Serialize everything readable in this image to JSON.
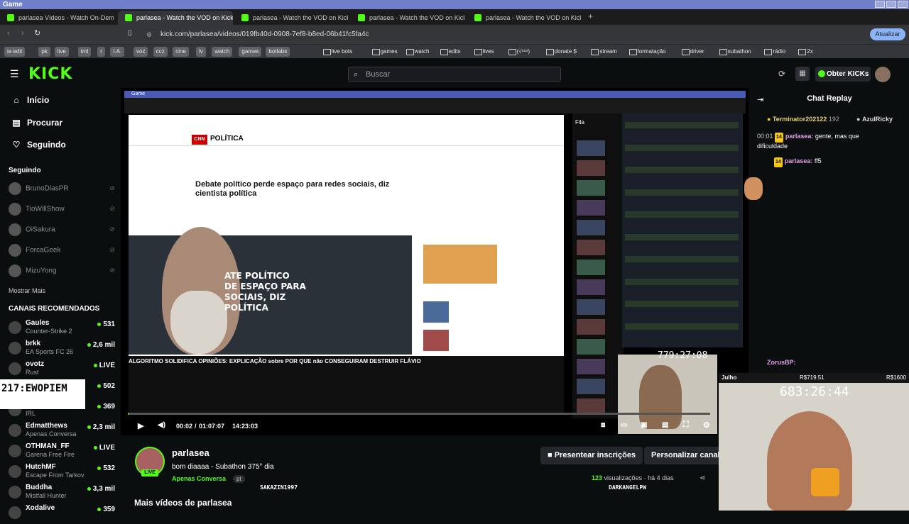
{
  "window": {
    "title": "Game"
  },
  "tabs": [
    {
      "label": "parlasea Vídeos - Watch On-Demand"
    },
    {
      "label": "parlasea - Watch the VOD on Kick"
    },
    {
      "label": "parlasea - Watch the VOD on Kick"
    },
    {
      "label": "parlasea - Watch the VOD on Kick"
    },
    {
      "label": "parlasea - Watch the VOD on Kick"
    }
  ],
  "address": {
    "url": "kick.com/parlasea/videos/019fb40d-0908-7ef8-b8ed-06b41fc5fa4c",
    "update_label": "Atualizar"
  },
  "bookmarks": [
    "ia edit",
    "pk",
    "live",
    "tml",
    "r",
    "I.A.",
    "voz",
    "ccz",
    "cine",
    "lv",
    "watch",
    "games",
    "botlabs",
    "live bots",
    "games",
    "watch",
    "edits",
    "lives",
    "(√ᵒ¹ᵒ)",
    "donate $",
    "stream",
    "formatação",
    "driver",
    "subathon",
    "rádio",
    "2x"
  ],
  "header": {
    "search_placeholder": "Buscar",
    "obter_label": "Obter KICKs",
    "logo": "KICK"
  },
  "sidebar": {
    "nav": [
      {
        "label": "Início"
      },
      {
        "label": "Procurar"
      },
      {
        "label": "Seguindo"
      }
    ],
    "following_title": "Seguindo",
    "following": [
      "BrunoDiasPR",
      "TioWillShow",
      "OiSakura",
      "ForcaGeek",
      "MizuYong"
    ],
    "show_more": "Mostrar Mais",
    "recommended_title": "CANAIS RECOMENDADOS",
    "recommended": [
      {
        "name": "Gaules",
        "game": "Counter-Strike 2",
        "viewers": "531"
      },
      {
        "name": "brkk",
        "game": "EA Sports FC 26",
        "viewers": "2,6 mil"
      },
      {
        "name": "ovotz",
        "game": "Rust",
        "viewers": "LIVE"
      },
      {
        "name": "",
        "game": "",
        "viewers": "502"
      },
      {
        "name": "",
        "game": "IRL",
        "viewers": "369"
      },
      {
        "name": "Edmatthews",
        "game": "Apenas Conversa",
        "viewers": "2,3 mil"
      },
      {
        "name": "OTHMAN_FF",
        "game": "Garena Free Fire",
        "viewers": "LIVE"
      },
      {
        "name": "HutchMF",
        "game": "Escape From Tarkov",
        "viewers": "532"
      },
      {
        "name": "Buddha",
        "game": "Mistfall Hunter",
        "viewers": "3,3 mil"
      },
      {
        "name": "Xodalive",
        "game": "",
        "viewers": "359"
      }
    ]
  },
  "video": {
    "inner_window_title": "Game",
    "cnn_section": "POLÍTICA",
    "cnn_logo": "CNN",
    "headline": "Debate político perde espaço para redes sociais, diz cientista política",
    "overlay_text": "ATE POLÍTICO\nDE ESPAÇO PARA\nSOCIAIS, DIZ\nPOLÍTICA",
    "yt_title": "ALGORITMO SOLIDIFICA OPINIÕES: EXPLICAÇÃO sobre POR QUE não CONSEGUIRAM DESTRUIR FLÁVIO",
    "fila_label": "Fila",
    "timer_small": "779:27:08",
    "timer_big": "683:26:44",
    "cam_label": "Julho",
    "overlay_code": "217:EWOPIEM",
    "time_current": "00:02",
    "time_total": "01:07:07",
    "time_clock": "14:23:03",
    "progress_fraction": 0.0005
  },
  "chat": {
    "title": "Chat Replay",
    "top_gifters": [
      {
        "name": "Terminator202122",
        "count": "192"
      },
      {
        "name": "AzulRicky",
        "count": ""
      }
    ],
    "messages": [
      {
        "time": "00:01",
        "badge": "14",
        "user": "parlasea:",
        "text": "gente, mas que",
        "cont": "dificuldade"
      },
      {
        "time": "",
        "badge": "14",
        "user": "parlasea:",
        "text": "ff5",
        "cont": ""
      }
    ],
    "zorus": "ZorusBP:",
    "money": "R$719.51",
    "money2": "R$1600"
  },
  "stream": {
    "streamer": "parlasea",
    "title": "bom diaaaa - Subathon 375° dia",
    "category": "Apenas Conversa",
    "lang": "pt",
    "live": "LIVE",
    "gift_btn": "Presentear inscrições",
    "custom_btn": "Personalizar canal",
    "views_count": "123",
    "views_label": "visualizações",
    "ago": "há 4 dias",
    "more_videos": "Mais vídeos de parlasea",
    "overlay_name1": "SAKAZIN1997",
    "overlay_name2": "DARKANGELPW"
  }
}
